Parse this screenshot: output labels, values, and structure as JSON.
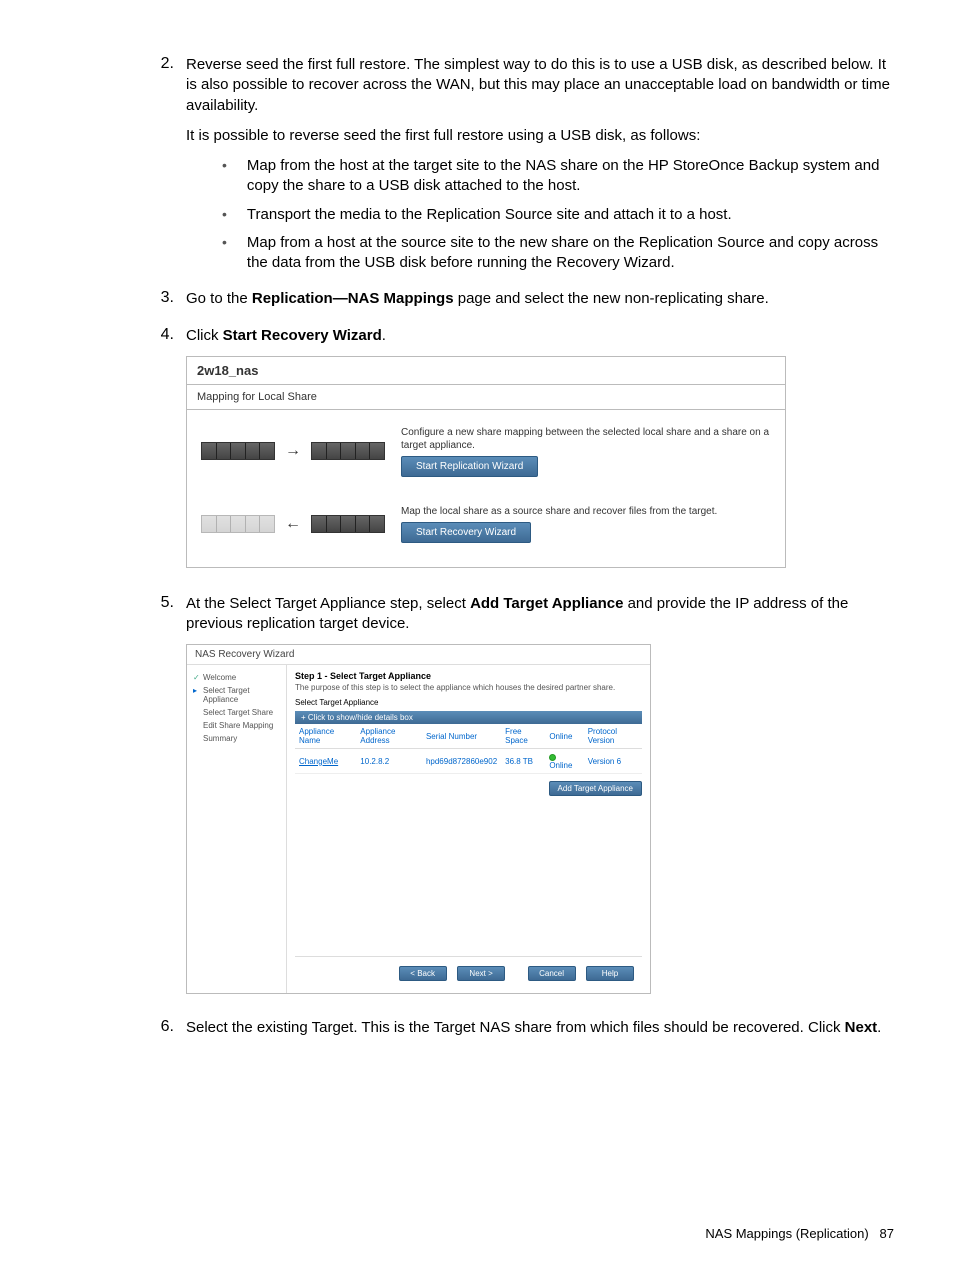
{
  "steps": {
    "s2": {
      "num": "2.",
      "p1": "Reverse seed the first full restore. The simplest way to do this is to use a USB disk, as described below. It is also possible to recover across the WAN, but this may place an unacceptable load on bandwidth or time availability.",
      "p2": "It is possible to reverse seed the first full restore using a USB disk, as follows:",
      "b1": "Map from the host at the target site to the NAS share on the HP StoreOnce Backup system and copy the share to a USB disk attached to the host.",
      "b2": "Transport the media to the Replication Source site and attach it to a host.",
      "b3": "Map from a host at the source site to the new share on the Replication Source and copy across the data from the USB disk before running the Recovery Wizard."
    },
    "s3": {
      "num": "3.",
      "t1": "Go to the ",
      "bold": "Replication—NAS Mappings",
      "t2": " page and select the new non-replicating share."
    },
    "s4": {
      "num": "4.",
      "t1": "Click ",
      "bold": "Start Recovery Wizard",
      "t2": "."
    },
    "s5": {
      "num": "5.",
      "t1": "At the Select Target Appliance step, select ",
      "bold": "Add Target Appliance",
      "t2": " and provide the IP address of the previous replication target device."
    },
    "s6": {
      "num": "6.",
      "t1": "Select the existing Target. This is the Target NAS share from which files should be recovered. Click ",
      "bold": "Next",
      "t2": "."
    }
  },
  "fig1": {
    "title": "2w18_nas",
    "subtitle": "Mapping for Local Share",
    "row1_desc": "Configure a new share mapping between the selected local share and a share on a target appliance.",
    "row1_btn": "Start Replication Wizard",
    "row2_desc": "Map the local share as a source share and recover files from the target.",
    "row2_btn": "Start Recovery Wizard"
  },
  "fig2": {
    "wintitle": "NAS Recovery Wizard",
    "side": {
      "welcome": "Welcome",
      "sel_app": "Select Target Appliance",
      "sel_share": "Select Target Share",
      "edit_map": "Edit Share Mapping",
      "summary": "Summary"
    },
    "main": {
      "heading": "Step 1 - Select Target Appliance",
      "sub": "The purpose of this step is to select the appliance which houses the desired partner share.",
      "sel_label": "Select Target Appliance",
      "bar": "+ Click to show/hide details box",
      "headers": {
        "name": "Appliance Name",
        "addr": "Appliance Address",
        "serial": "Serial Number",
        "free": "Free Space",
        "online": "Online",
        "proto": "Protocol Version"
      },
      "row": {
        "name": "ChangeMe",
        "addr": "10.2.8.2",
        "serial": "hpd69d872860e902",
        "free": "36.8 TB",
        "online": "Online",
        "proto": "Version 6"
      },
      "addbtn": "Add Target Appliance"
    },
    "foot": {
      "back": "< Back",
      "next": "Next >",
      "cancel": "Cancel",
      "help": "Help"
    }
  },
  "footer": {
    "label": "NAS Mappings (Replication)",
    "page": "87"
  }
}
